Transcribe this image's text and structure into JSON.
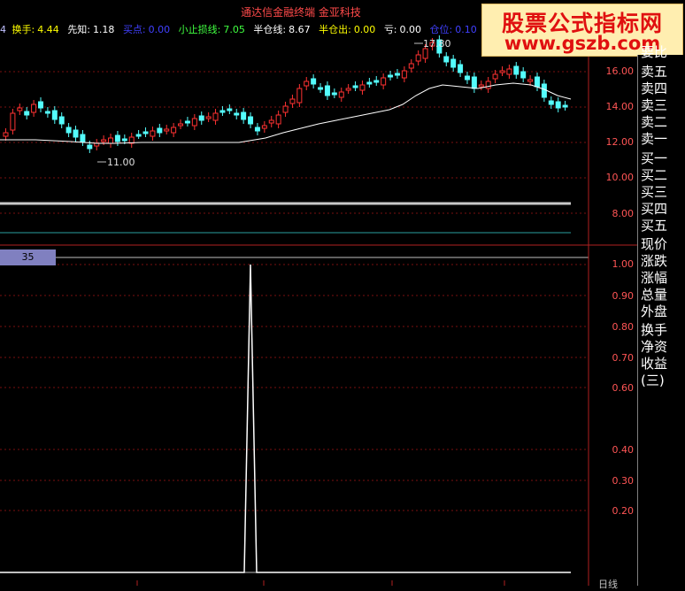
{
  "window": {
    "title": "通达信金融终端    金亚科技"
  },
  "watermark": {
    "line1": "股票公式指标网",
    "line2": "www.gszb.com"
  },
  "indicators": {
    "prefix": "4",
    "huanshou_label": "换手:",
    "huanshou_value": "4.44",
    "xianzhi_label": "先知:",
    "xianzhi_value": "1.18",
    "maidian_label": "买点:",
    "maidian_value": "0.00",
    "zhisun_label": "小止损线:",
    "zhisun_value": "7.05",
    "bancangxian_label": "半仓线:",
    "bancangxian_value": "8.67",
    "bancangchu_label": "半仓出:",
    "bancangchu_value": "0.00",
    "kui_label": "亏:",
    "kui_value": "0.00",
    "cangwei_label": "仓位:",
    "cangwei_value": "0.10"
  },
  "price_axis": {
    "ticks": [
      "16.00",
      "14.00",
      "12.00",
      "10.00",
      "8.00"
    ]
  },
  "annotations": {
    "high": "17.80",
    "low": "11.00"
  },
  "sub_axis": {
    "ticks": [
      "1.00",
      "0.90",
      "0.80",
      "0.70",
      "0.60",
      "0.40",
      "0.30",
      "0.20"
    ]
  },
  "sub_tab": {
    "label": "35"
  },
  "side_panel": {
    "items": [
      "要比",
      "卖五",
      "卖四",
      "卖三",
      "卖二",
      "卖一",
      "买一",
      "买二",
      "买三",
      "买四",
      "买五",
      "现价",
      "涨跌",
      "涨幅",
      "总量",
      "外盘",
      "换手",
      "净资",
      "收益(三)"
    ]
  },
  "bottom": {
    "tab_label": "日线"
  },
  "colors": {
    "up": "#ff3232",
    "down": "#54fcfc",
    "ma": "#ffffff",
    "grid": "#7a1010",
    "axis_text": "#ff5555"
  }
}
